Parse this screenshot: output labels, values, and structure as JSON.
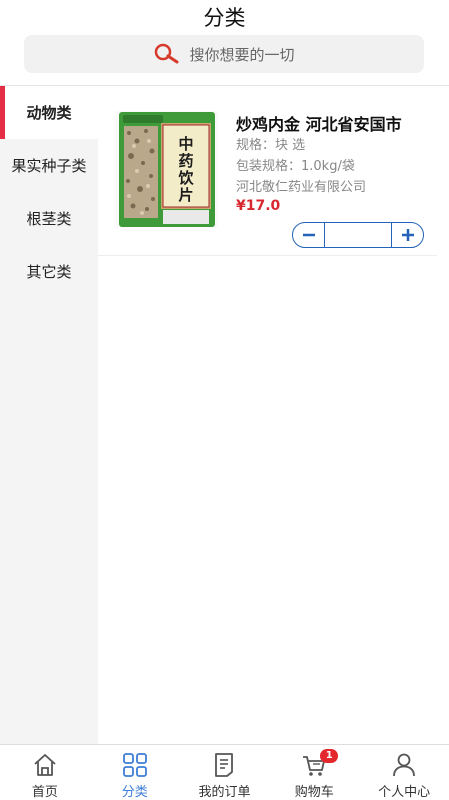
{
  "header": {
    "title": "分类",
    "search_placeholder": "搜你想要的一切"
  },
  "sidebar": {
    "items": [
      {
        "label": "动物类",
        "active": true
      },
      {
        "label": "果实种子类",
        "active": false
      },
      {
        "label": "根茎类",
        "active": false
      },
      {
        "label": "其它类",
        "active": false
      }
    ]
  },
  "product": {
    "name": "炒鸡内金 河北省安国市",
    "spec": "规格：块 选",
    "package": "包装规格：1.0kg/袋",
    "manufacturer": "河北敬仁药业有限公司",
    "price": "¥17.0",
    "quantity": "",
    "image_text": "中药饮片"
  },
  "tabbar": {
    "tabs": [
      {
        "label": "首页",
        "icon": "home-icon",
        "active": false
      },
      {
        "label": "分类",
        "icon": "category-icon",
        "active": true
      },
      {
        "label": "我的订单",
        "icon": "orders-icon",
        "active": false
      },
      {
        "label": "购物车",
        "icon": "cart-icon",
        "active": false,
        "badge": "1"
      },
      {
        "label": "个人中心",
        "icon": "profile-icon",
        "active": false
      }
    ]
  },
  "colors": {
    "accent_red": "#e52d46",
    "price_red": "#d8282f",
    "active_blue": "#3d7ed6",
    "stepper_blue": "#2563b8"
  }
}
